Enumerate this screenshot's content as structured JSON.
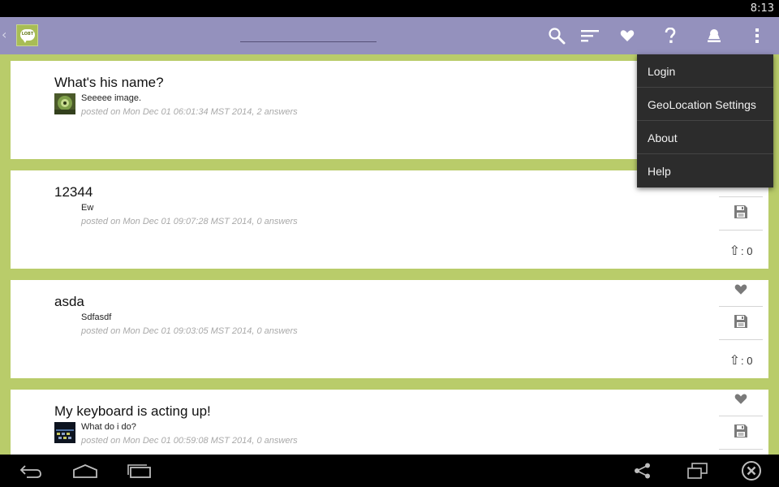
{
  "status_bar": {
    "time": "8:13"
  },
  "app": {
    "logo_text": "LOBT",
    "accent": "#9491bd",
    "background": "#b9cc6a"
  },
  "toolbar": {
    "icons": [
      "search-icon",
      "sort-icon",
      "heart-icon",
      "help-icon",
      "account-icon",
      "overflow-menu-icon"
    ]
  },
  "posts": [
    {
      "title": "What's his name?",
      "body": "Seeeee image.",
      "meta": "posted on Mon Dec 01 06:01:34 MST 2014, 2 answers",
      "has_thumbnail": true,
      "votes": ""
    },
    {
      "title": "12344",
      "body": "Ew",
      "meta": "posted on Mon Dec 01 09:07:28 MST 2014, 0 answers",
      "has_thumbnail": false,
      "votes": ": 0"
    },
    {
      "title": "asda",
      "body": "Sdfasdf",
      "meta": "posted on Mon Dec 01 09:03:05 MST 2014, 0 answers",
      "has_thumbnail": false,
      "votes": ": 0"
    },
    {
      "title": "My keyboard is acting up!",
      "body": "What do i do?",
      "meta": "posted on Mon Dec 01 00:59:08 MST 2014, 0 answers",
      "has_thumbnail": true,
      "votes": ""
    }
  ],
  "menu": {
    "items": [
      "Login",
      "GeoLocation Settings",
      "About",
      "Help"
    ]
  },
  "nav_bar": {
    "icons": [
      "back-icon",
      "home-icon",
      "recent-apps-icon",
      "share-icon",
      "window-icon",
      "close-icon"
    ]
  }
}
